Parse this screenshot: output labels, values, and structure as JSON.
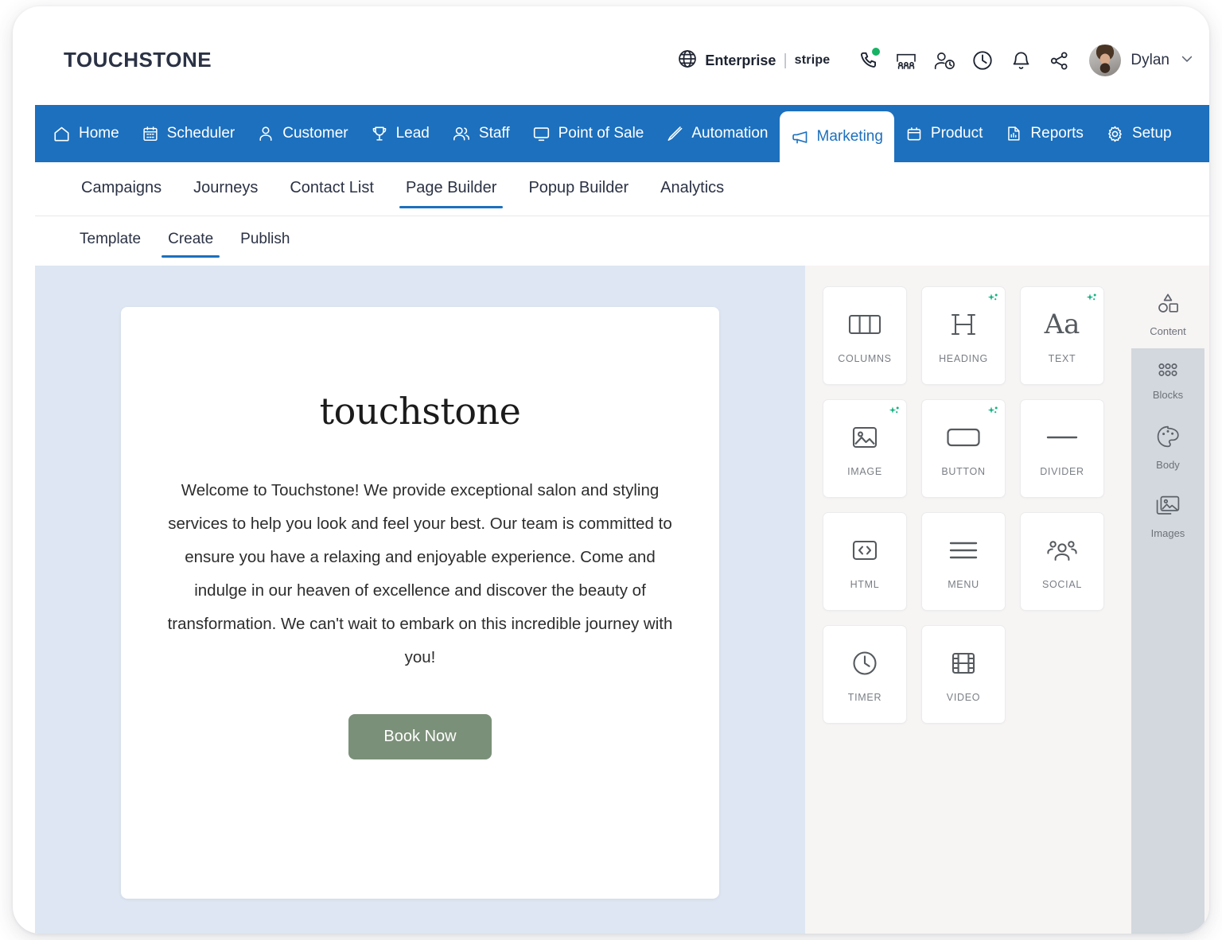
{
  "header": {
    "brand": "TOUCHSTONE",
    "plan": "Enterprise",
    "separator": "|",
    "payment_provider": "stripe",
    "username": "Dylan",
    "icons": [
      "globe-icon",
      "phone-icon",
      "meeting-room-icon",
      "user-clock-icon",
      "clock-icon",
      "bell-icon",
      "share-icon"
    ],
    "presence_status_color": "#16b364"
  },
  "primary_nav": {
    "active": "Marketing",
    "items": [
      {
        "label": "Home",
        "icon": "home-icon"
      },
      {
        "label": "Scheduler",
        "icon": "calendar-icon"
      },
      {
        "label": "Customer",
        "icon": "user-icon"
      },
      {
        "label": "Lead",
        "icon": "trophy-icon"
      },
      {
        "label": "Staff",
        "icon": "users-icon"
      },
      {
        "label": "Point of Sale",
        "icon": "monitor-icon"
      },
      {
        "label": "Automation",
        "icon": "pen-icon"
      },
      {
        "label": "Marketing",
        "icon": "megaphone-icon"
      },
      {
        "label": "Product",
        "icon": "bag-icon"
      },
      {
        "label": "Reports",
        "icon": "report-icon"
      },
      {
        "label": "Setup",
        "icon": "gear-icon"
      }
    ],
    "search_icon": "search-icon",
    "background_color": "#1c70be"
  },
  "secondary_nav": {
    "active": "Page Builder",
    "items": [
      "Campaigns",
      "Journeys",
      "Contact List",
      "Page Builder",
      "Popup Builder",
      "Analytics"
    ],
    "accent_color": "#1c70be"
  },
  "third_nav": {
    "active": "Create",
    "items": [
      "Template",
      "Create",
      "Publish"
    ]
  },
  "canvas": {
    "background_color": "#dde6f2",
    "logo_text": "touchstone",
    "body_text": "Welcome to Touchstone! We provide exceptional salon and styling services to help you look and feel your best. Our team is committed to ensure you have a relaxing and enjoyable experience. Come and indulge in our heaven of excellence and discover the beauty of transformation. We can't wait to embark on this incredible journey with you!",
    "cta_label": "Book Now",
    "cta_color": "#7b9078"
  },
  "palette": {
    "sparkle_color": "#16b183",
    "widgets": [
      {
        "label": "COLUMNS",
        "icon": "columns-icon",
        "ai": false
      },
      {
        "label": "HEADING",
        "icon": "heading-icon",
        "ai": true
      },
      {
        "label": "TEXT",
        "icon": "text-icon",
        "ai": true
      },
      {
        "label": "IMAGE",
        "icon": "image-icon",
        "ai": true
      },
      {
        "label": "BUTTON",
        "icon": "button-icon",
        "ai": true
      },
      {
        "label": "DIVIDER",
        "icon": "divider-icon",
        "ai": false
      },
      {
        "label": "HTML",
        "icon": "code-icon",
        "ai": false
      },
      {
        "label": "MENU",
        "icon": "menu-icon",
        "ai": false
      },
      {
        "label": "SOCIAL",
        "icon": "social-icon",
        "ai": false
      },
      {
        "label": "TIMER",
        "icon": "timer-icon",
        "ai": false
      },
      {
        "label": "VIDEO",
        "icon": "video-icon",
        "ai": false
      }
    ]
  },
  "rail": {
    "active": "Content",
    "items": [
      {
        "label": "Content",
        "icon": "shapes-icon"
      },
      {
        "label": "Blocks",
        "icon": "grid-dots-icon"
      },
      {
        "label": "Body",
        "icon": "palette-icon"
      },
      {
        "label": "Images",
        "icon": "images-icon"
      }
    ]
  }
}
